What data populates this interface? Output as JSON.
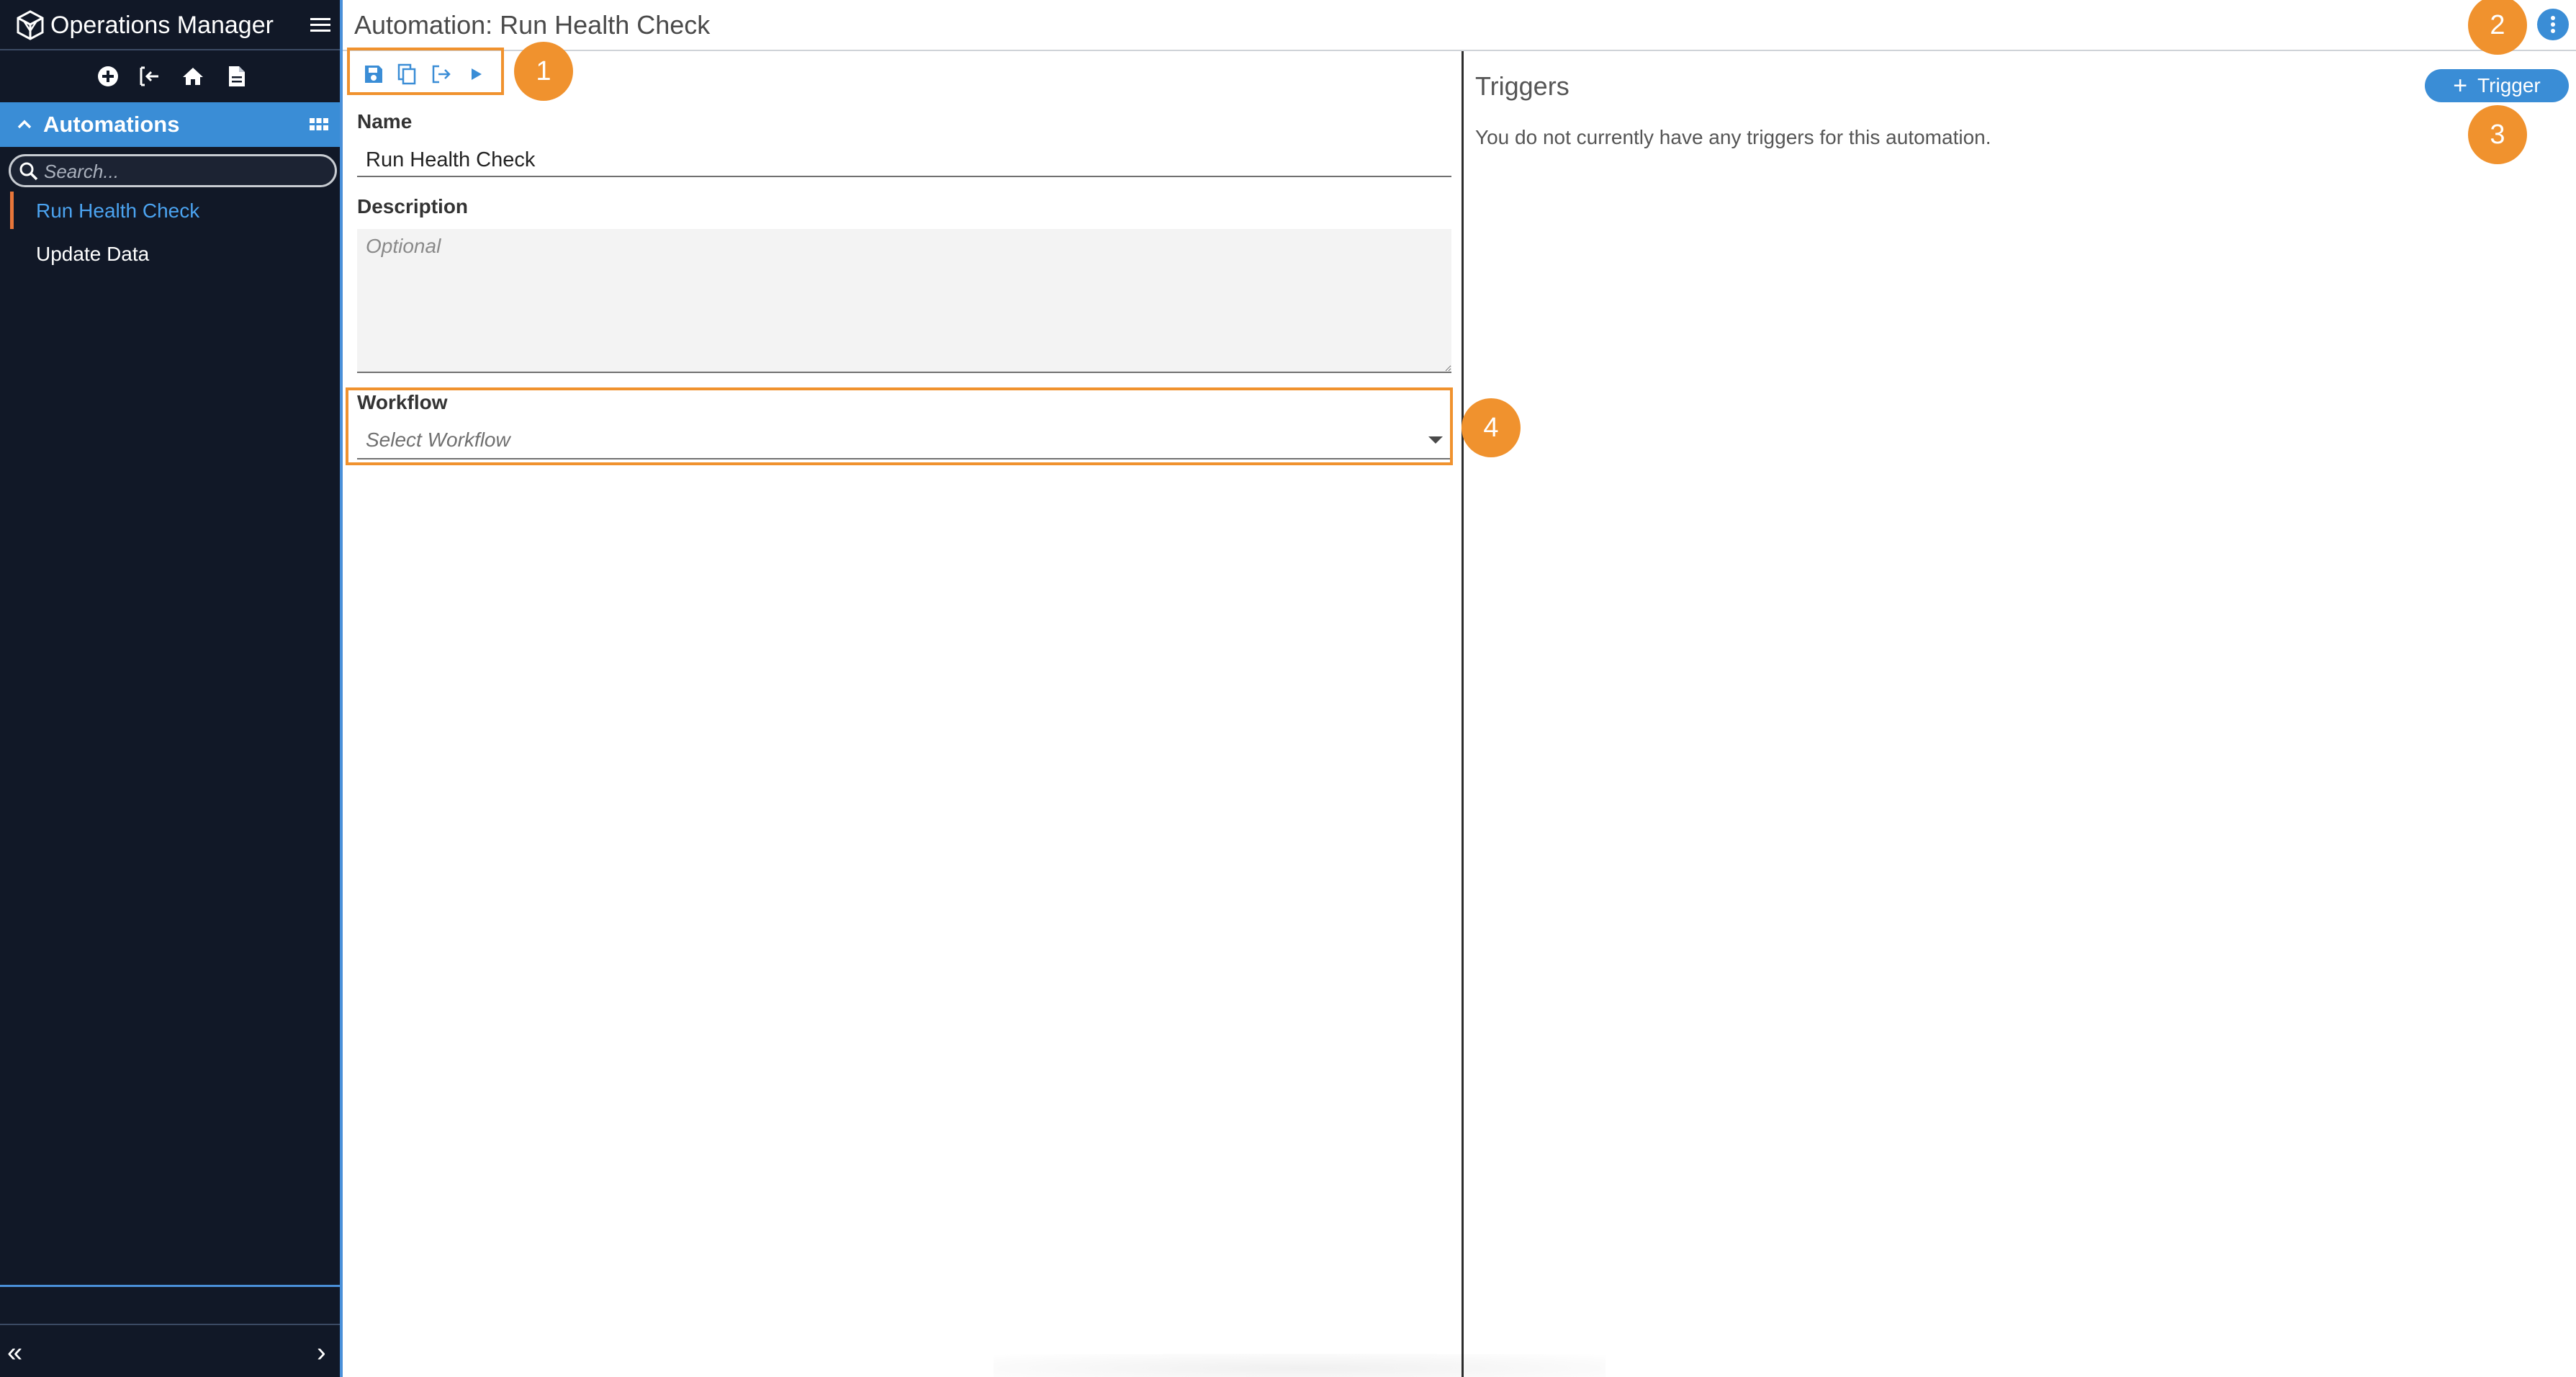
{
  "app": {
    "title": "Operations Manager"
  },
  "sidebar": {
    "section_title": "Automations",
    "search_placeholder": "Search...",
    "items": [
      {
        "label": "Run Health Check",
        "active": true
      },
      {
        "label": "Update Data",
        "active": false
      }
    ],
    "toolbar_icons": [
      "add-circle-icon",
      "exit-icon",
      "home-icon",
      "document-icon"
    ],
    "collapse_left": "«",
    "collapse_right": "›"
  },
  "page": {
    "title": "Automation: Run Health Check"
  },
  "editor": {
    "toolbar_icons": [
      "save-icon",
      "copy-icon",
      "export-icon",
      "run-icon"
    ],
    "name_label": "Name",
    "name_value": "Run Health Check",
    "description_label": "Description",
    "description_placeholder": "Optional",
    "workflow_label": "Workflow",
    "workflow_placeholder": "Select Workflow"
  },
  "triggers": {
    "title": "Triggers",
    "add_button_plus": "+",
    "add_button_label": "Trigger",
    "empty_message": "You do not currently have any triggers for this automation."
  },
  "annotations": {
    "callout_1": "1",
    "callout_2": "2",
    "callout_3": "3",
    "callout_4": "4"
  },
  "colors": {
    "sidebar_bg": "#111827",
    "accent_blue": "#3a8dd6",
    "active_item": "#4ba3f0",
    "active_marker": "#e8763a",
    "callout_orange": "#f0922e"
  }
}
